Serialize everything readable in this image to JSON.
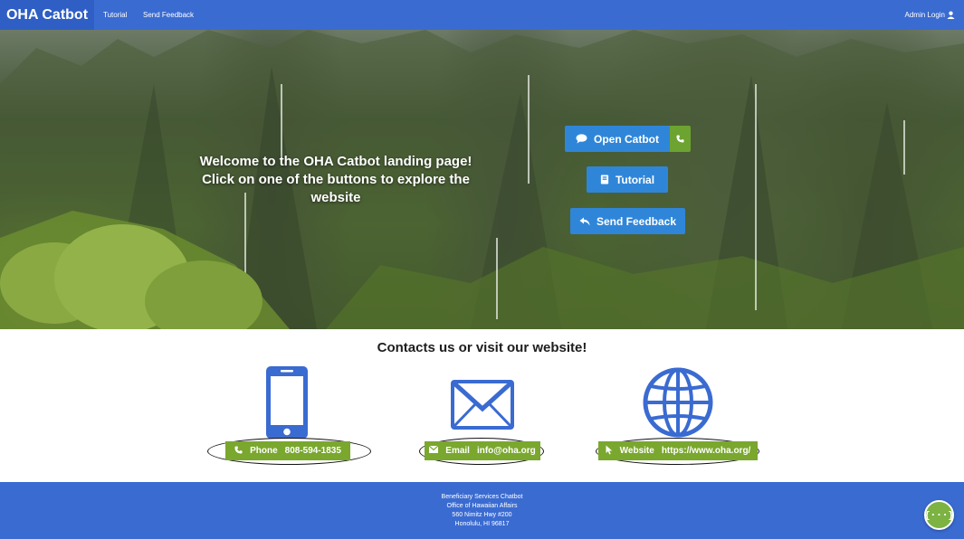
{
  "navbar": {
    "brand": "OHA Catbot",
    "tutorial": "Tutorial",
    "send_feedback": "Send Feedback",
    "admin_login": "Admin Login",
    "admin_icon": "user-icon"
  },
  "hero": {
    "welcome_lines": [
      "Welcome to the OHA Catbot landing page!",
      "Click on one of the buttons to explore the",
      "website"
    ],
    "buttons": {
      "open_catbot": "Open Catbot",
      "tutorial": "Tutorial",
      "send_feedback": "Send Feedback"
    },
    "icons": {
      "open_catbot": "chat-bubble-icon",
      "call": "phone-icon",
      "tutorial": "book-icon",
      "send_feedback": "reply-arrow-icon"
    }
  },
  "contacts": {
    "title": "Contacts us or visit our website!",
    "items": [
      {
        "label": "Phone",
        "value": "808-594-1835",
        "icon": "smartphone-icon"
      },
      {
        "label": "Email",
        "value": "info@oha.org",
        "icon": "envelope-icon"
      },
      {
        "label": "Website",
        "value": "https://www.oha.org/",
        "icon": "globe-icon"
      }
    ]
  },
  "footer": {
    "lines": [
      "Beneficiary Services Chatbot",
      "Office of Hawaiian Affairs",
      "560 Nimitz Hwy #200",
      "Honolulu, HI 96817"
    ],
    "fab_label": "{···}"
  },
  "colors": {
    "nav_blue": "#3a6bd1",
    "button_blue": "#2f86d9",
    "accent_green": "#7aa72e",
    "icon_blue": "#3a6bd1"
  }
}
